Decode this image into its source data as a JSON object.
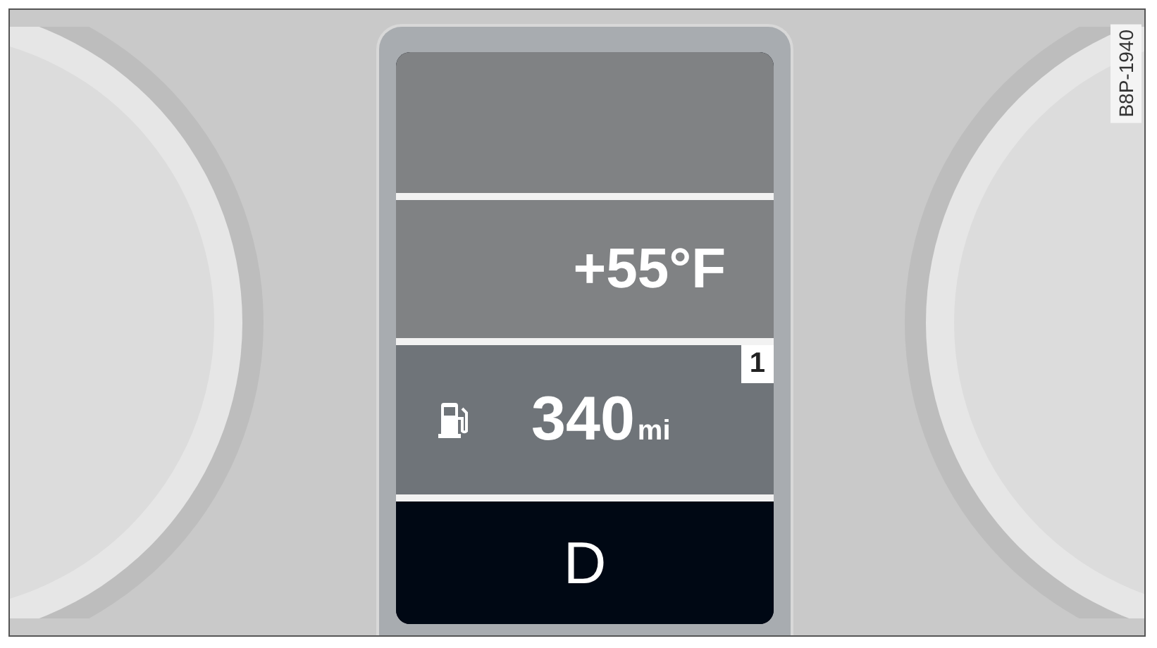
{
  "display": {
    "temperature": "+55°F",
    "range": {
      "value": "340",
      "unit": "mi"
    },
    "memory_badge": "1",
    "gear": "D"
  },
  "figure_code": "B8P-1940"
}
